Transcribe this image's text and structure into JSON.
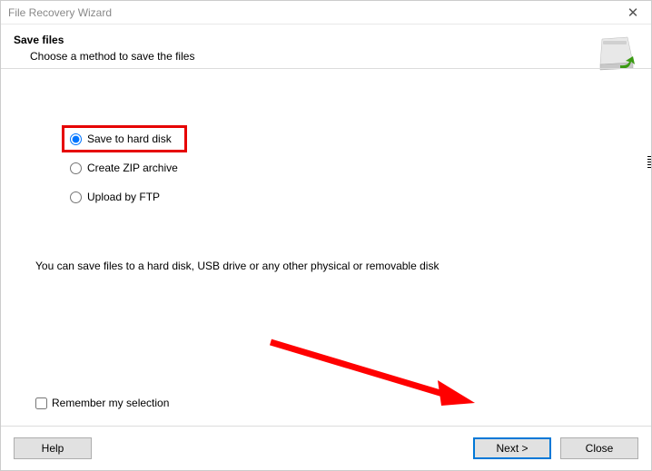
{
  "window": {
    "title": "File Recovery Wizard"
  },
  "header": {
    "title": "Save files",
    "subtitle": "Choose a method to save the files"
  },
  "options": {
    "hard_disk": "Save to hard disk",
    "zip": "Create ZIP archive",
    "ftp": "Upload by FTP"
  },
  "description": "You can save files to a hard disk, USB drive or any other physical or removable disk",
  "remember_label": "Remember my selection",
  "buttons": {
    "help": "Help",
    "next": "Next >",
    "close": "Close"
  }
}
